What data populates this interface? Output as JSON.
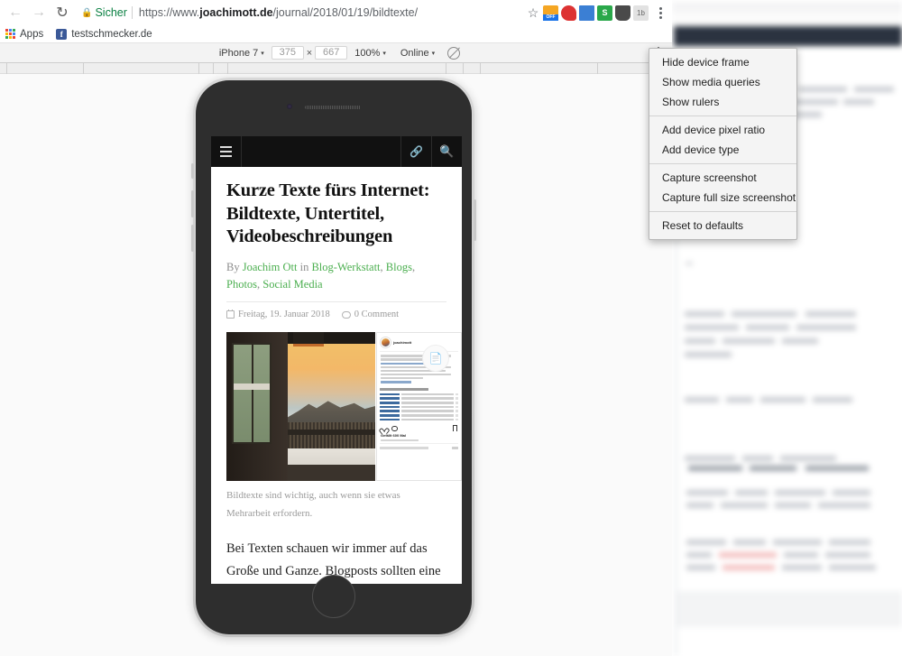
{
  "browser": {
    "nav": {
      "back": "←",
      "forward": "→",
      "reload": "↻"
    },
    "security_label": "Sicher",
    "url": {
      "scheme": "https://www.",
      "host": "joachimott.de",
      "path": "/journal/2018/01/19/bildtexte/"
    },
    "star_icon": "☆",
    "bookmarks": [
      {
        "label": "Apps",
        "icon": "apps-grid-icon"
      },
      {
        "label": "testschmecker.de",
        "icon": "facebook-icon"
      }
    ],
    "extensions": [
      "adblock-off-icon",
      "evernote-icon",
      "colorpick-icon",
      "stylebot-icon",
      "pocket-icon",
      "onebox-icon"
    ],
    "menu_icon": "kebab-menu-icon"
  },
  "device_toolbar": {
    "device": "iPhone 7",
    "width": "375",
    "height": "667",
    "multiply": "×",
    "zoom": "100%",
    "throttling": "Online",
    "caret": "▾",
    "no_cache_icon": "no-cache-icon",
    "options_icon": "kebab-menu-icon"
  },
  "context_menu": {
    "groups": [
      [
        "Hide device frame",
        "Show media queries",
        "Show rulers"
      ],
      [
        "Add device pixel ratio",
        "Add device type"
      ],
      [
        "Capture screenshot",
        "Capture full size screenshot"
      ],
      [
        "Reset to defaults"
      ]
    ]
  },
  "site": {
    "header": {
      "menu_icon": "hamburger-icon",
      "link_icon": "link-icon",
      "search_icon": "search-icon"
    },
    "article": {
      "title": "Kurze Texte fürs Internet: Bildtexte, Untertitel, Videobeschreibungen",
      "byline_prefix": "By",
      "author": "Joachim Ott",
      "byline_in": "in",
      "categories": [
        "Blog-Werkstatt",
        "Blogs",
        "Photos",
        "Social Media"
      ],
      "date": "Freitag, 19. Januar 2018",
      "comments": "0 Comment",
      "caption": "Bildtexte sind wichtig, auch wenn sie etwas Mehrarbeit erfordern.",
      "body": "Bei Texten schauen wir immer auf das Große und Ganze. Blogposts sollten eine bestimmte Mindest-Länge haben, das ist suchmaschinenfreundlicher. Und was ist mit",
      "instagram": {
        "username": "joachimott",
        "likes": "Gefällt 600 Mal"
      }
    }
  },
  "colors": {
    "accent_green": "#4caf50",
    "secure_green": "#0b8043",
    "header_black": "#111111",
    "menu_bg": "#f4f4f4"
  }
}
